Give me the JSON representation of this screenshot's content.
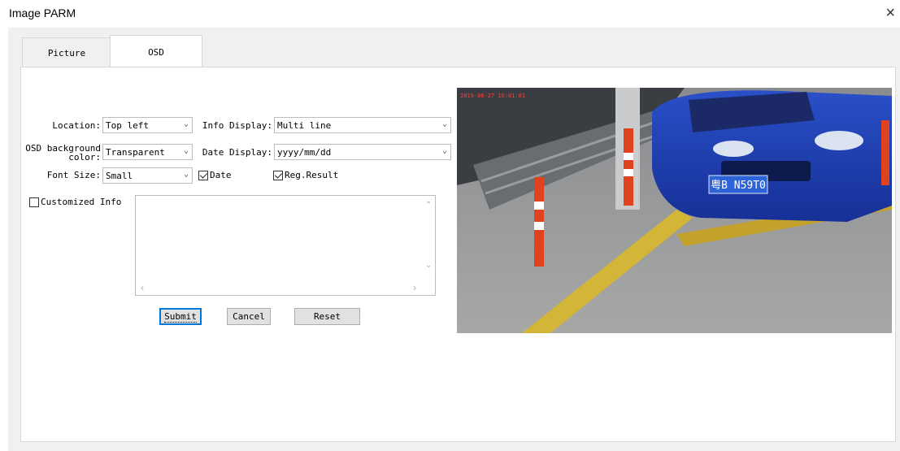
{
  "window": {
    "title": "Image PARM",
    "close_symbol": "×"
  },
  "tabs": [
    {
      "label": "Picture"
    },
    {
      "label": "OSD"
    }
  ],
  "form": {
    "location": {
      "label": "Location:",
      "value": "Top left"
    },
    "info_display": {
      "label": "Info Display:",
      "value": "Multi line"
    },
    "osd_background": {
      "label_line1": "OSD background",
      "label_line2": "color:",
      "value": "Transparent"
    },
    "date_display": {
      "label": "Date Display:",
      "value": "yyyy/mm/dd"
    },
    "font_size": {
      "label": "Font Size:",
      "value": "Small"
    },
    "date_checkbox": {
      "label": "Date",
      "checked": true
    },
    "reg_result_checkbox": {
      "label": "Reg.Result",
      "checked": true
    },
    "customized_info": {
      "label": "Customized Info",
      "checked": false,
      "value": ""
    }
  },
  "buttons": {
    "submit": "Submit",
    "cancel": "Cancel",
    "reset": "Reset"
  },
  "preview": {
    "plate_text": "粤B N59T0",
    "timestamp": "2019-06-27 16:01:01"
  },
  "icons": {
    "dropdown": "chevron-down-icon",
    "scroll_up": "chevron-up-icon",
    "scroll_down": "chevron-down-icon",
    "scroll_left": "chevron-left-icon",
    "scroll_right": "chevron-right-icon"
  },
  "colors": {
    "accent": "#0078d7",
    "panel_bg": "#f0f0f0"
  }
}
